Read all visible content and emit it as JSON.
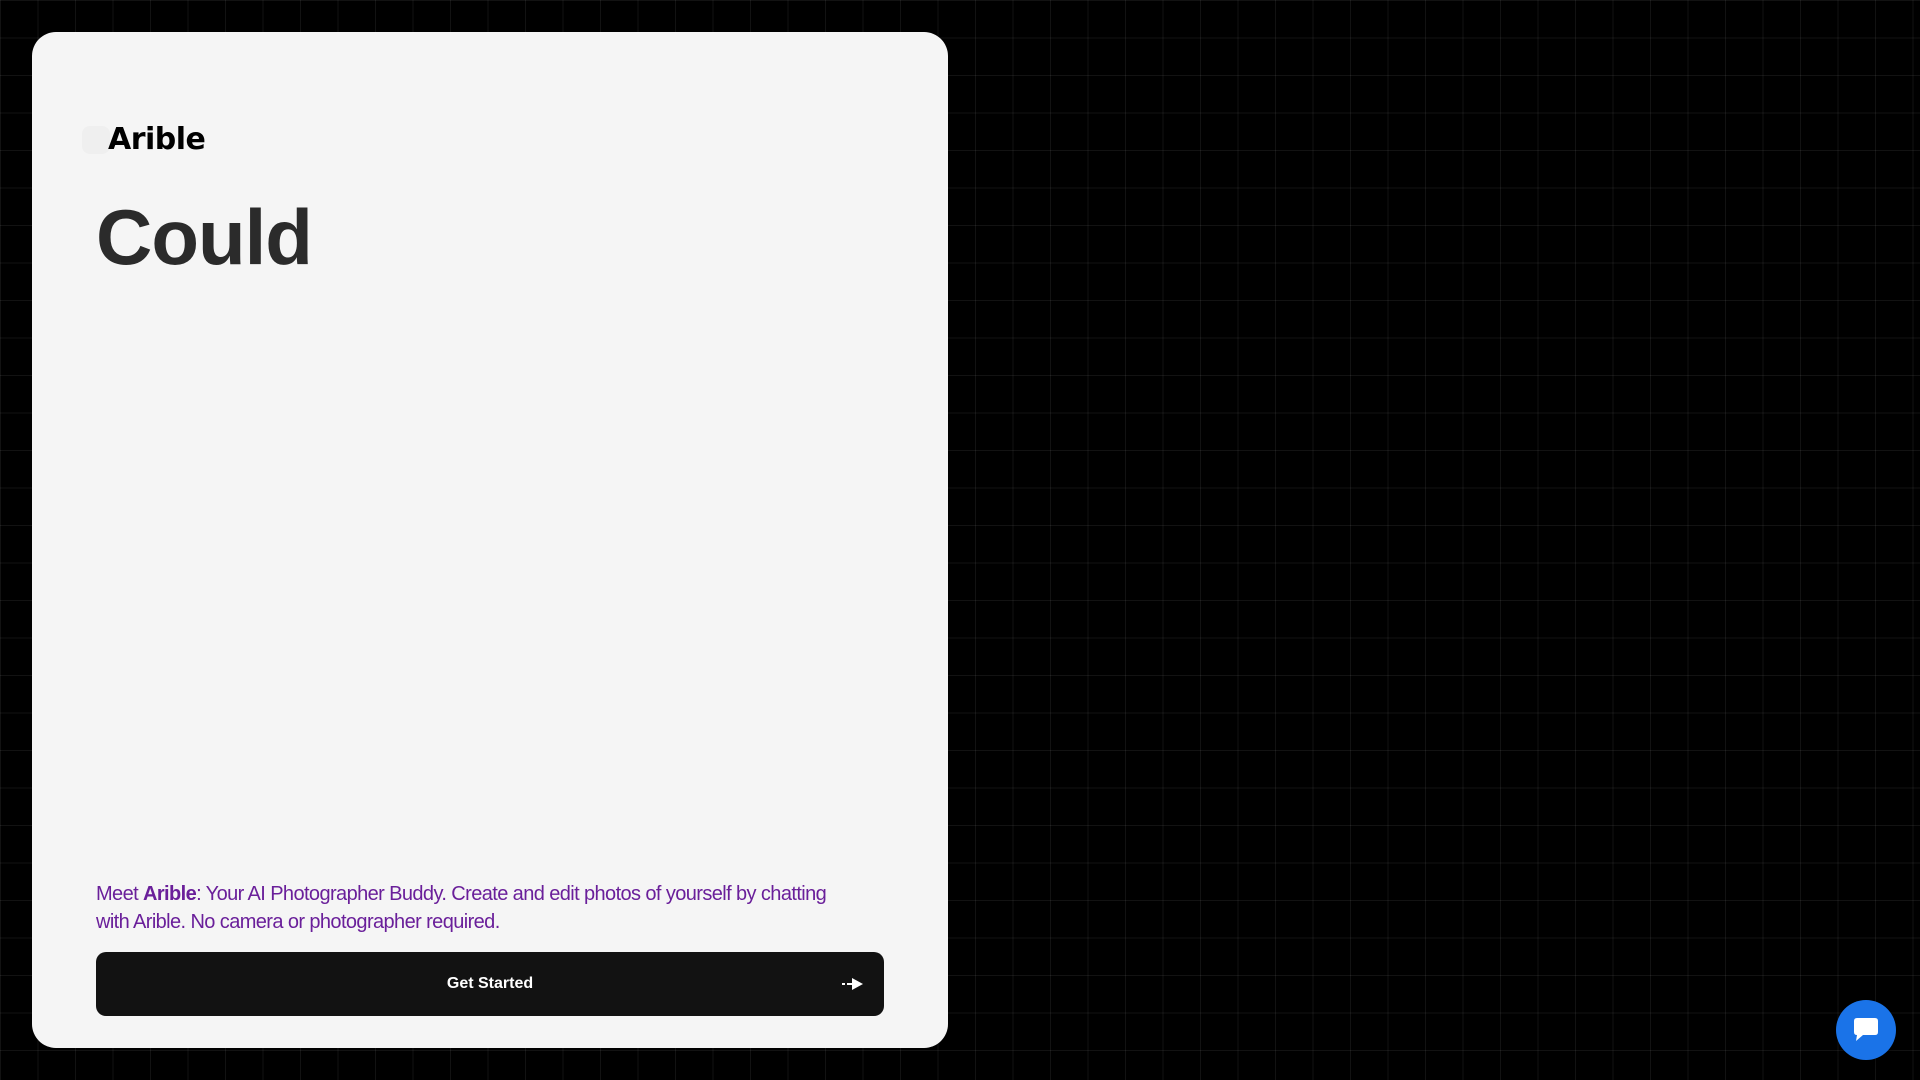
{
  "brand": {
    "name": "Arible"
  },
  "hero": {
    "headline": "Could"
  },
  "tagline": {
    "lead": "Meet ",
    "brand": "Arible",
    "rest": ": Your AI Photographer Buddy. Create and edit photos of yourself by chatting with Arible. No camera or photographer required."
  },
  "cta": {
    "label": "Get Started",
    "icon": "arrow-right-icon"
  },
  "chat_widget": {
    "icon": "chat-bubble-icon"
  },
  "colors": {
    "background": "#000000",
    "card": "#f5f5f5",
    "headline": "#2b2b2b",
    "tagline": "#6a1f9a",
    "button": "#121212",
    "chat_button": "#1a73e8"
  }
}
